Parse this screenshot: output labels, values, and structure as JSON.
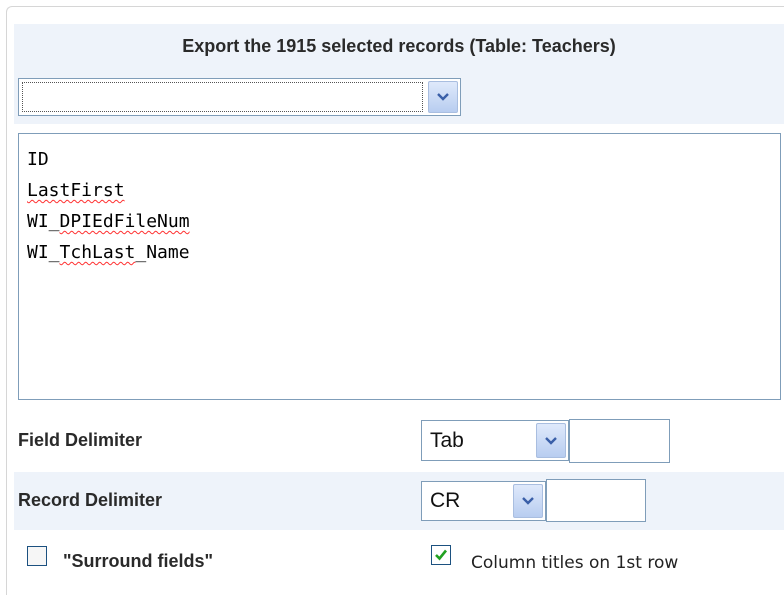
{
  "export": {
    "title": "Export the 1915 selected records (Table: Teachers)",
    "field_select_value": "",
    "fields": [
      "ID",
      "LastFirst",
      "WI_DPIEdFileNum",
      "WI_TchLast_Name"
    ]
  },
  "field_delimiter": {
    "label": "Field Delimiter",
    "selected": "Tab",
    "custom_value": ""
  },
  "record_delimiter": {
    "label": "Record Delimiter",
    "selected": "CR",
    "custom_value": ""
  },
  "options": {
    "surround_fields": {
      "label": "\"Surround fields\"",
      "checked": false
    },
    "column_titles": {
      "label": "Column titles on 1st row",
      "checked": true
    }
  },
  "colors": {
    "band": "#eef3fa",
    "border": "#7f9db9",
    "check_green": "#21a121"
  }
}
